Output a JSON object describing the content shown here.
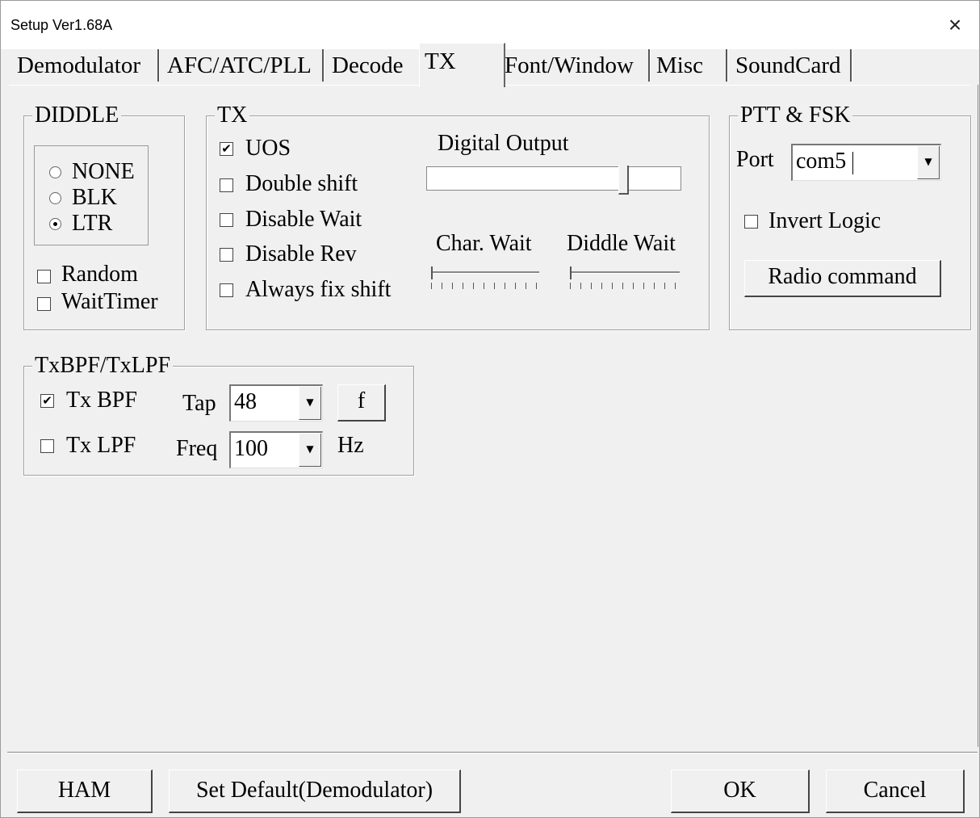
{
  "window": {
    "title": "Setup Ver1.68A",
    "close_label": "×"
  },
  "tabs": [
    {
      "label": "Demodulator"
    },
    {
      "label": "AFC/ATC/PLL"
    },
    {
      "label": "Decode"
    },
    {
      "label": "TX"
    },
    {
      "label": "Font/Window"
    },
    {
      "label": "Misc"
    },
    {
      "label": "SoundCard"
    }
  ],
  "active_tab": "TX",
  "diddle": {
    "title": "DIDDLE",
    "options": [
      {
        "label": "NONE",
        "selected": false
      },
      {
        "label": "BLK",
        "selected": false
      },
      {
        "label": "LTR",
        "selected": true
      }
    ],
    "random": {
      "label": "Random",
      "checked": false
    },
    "wait_timer": {
      "label": "WaitTimer",
      "checked": false
    }
  },
  "tx": {
    "title": "TX",
    "uos": {
      "label": "UOS",
      "checked": true
    },
    "double_shift": {
      "label": "Double shift",
      "checked": false
    },
    "disable_wait": {
      "label": "Disable Wait",
      "checked": false
    },
    "disable_rev": {
      "label": "Disable Rev",
      "checked": false
    },
    "always_fix_shift": {
      "label": "Always fix shift",
      "checked": false
    },
    "digital_output": {
      "label": "Digital Output",
      "level": 0.8
    },
    "char_wait": {
      "label": "Char. Wait",
      "level": 0.0
    },
    "diddle_wait": {
      "label": "Diddle Wait",
      "level": 0.0
    }
  },
  "ptt": {
    "title": "PTT & FSK",
    "port_label": "Port",
    "port_value": "com5",
    "invert_logic": {
      "label": "Invert Logic",
      "checked": false
    },
    "radio_command_label": "Radio command"
  },
  "txbpf": {
    "title": "TxBPF/TxLPF",
    "tx_bpf": {
      "label": "Tx BPF",
      "checked": true
    },
    "tap_label": "Tap",
    "tap_value": "48",
    "f_button": "f",
    "tx_lpf": {
      "label": "Tx LPF",
      "checked": false
    },
    "freq_label": "Freq",
    "freq_value": "100",
    "hz_label": "Hz"
  },
  "footer": {
    "ham": "HAM",
    "set_default": "Set Default(Demodulator)",
    "ok": "OK",
    "cancel": "Cancel"
  },
  "glyphs": {
    "check": "✔",
    "arrow": "▼"
  }
}
